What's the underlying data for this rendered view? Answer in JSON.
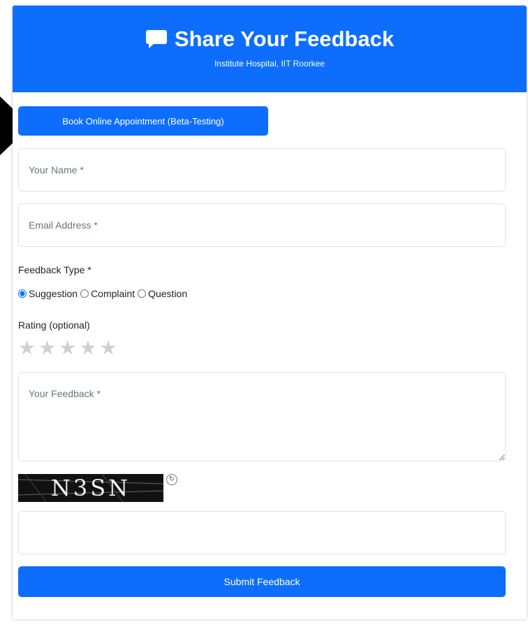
{
  "header": {
    "title": "Share Your Feedback",
    "subtitle": "Institute Hospital, IIT Roorkee",
    "title_icon": "comment-icon"
  },
  "book_button_label": "Book Online Appointment (Beta-Testing)",
  "form": {
    "name_placeholder": "Your Name *",
    "name_value": "",
    "email_placeholder": "Email Address *",
    "email_value": "",
    "feedback_type_label": "Feedback Type *",
    "feedback_type_options": [
      "Suggestion",
      "Complaint",
      "Question"
    ],
    "feedback_type_selected": "Suggestion",
    "rating_label": "Rating (optional)",
    "rating_value": 0,
    "rating_max": 5,
    "feedback_placeholder": "Your Feedback *",
    "feedback_value": "",
    "captcha_text": "N3SN",
    "captcha_refresh_icon": "refresh-icon",
    "captcha_value": "",
    "submit_label": "Submit Feedback"
  },
  "colors": {
    "primary": "#0d6efd",
    "star_inactive": "#d0d0d0"
  }
}
